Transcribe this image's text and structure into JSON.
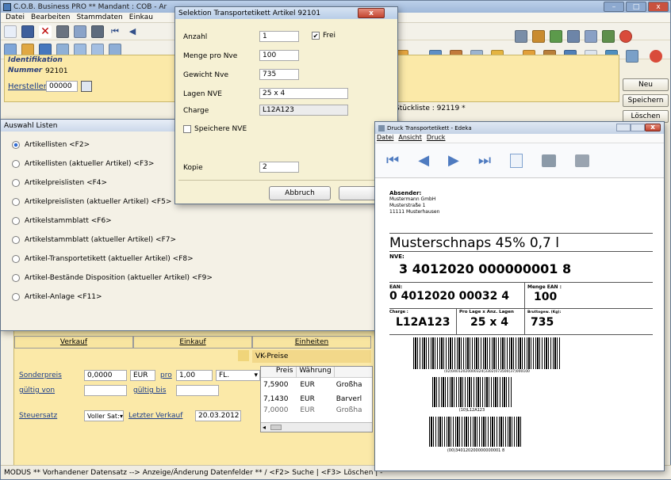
{
  "main_window": {
    "title": "C.O.B. Business PRO  ** Mandant : COB - Ar",
    "menu": [
      "Datei",
      "Bearbeiten",
      "Stammdaten",
      "Einkau"
    ],
    "window_controls": [
      "–",
      "□",
      "x"
    ]
  },
  "identification": {
    "heading": "Identifikation",
    "nummer_label": "Nummer",
    "nummer_value": "92101",
    "hersteller_label": "Hersteller",
    "hersteller_value": "00000",
    "stueckliste": "Stückliste : 92119 *"
  },
  "side_buttons": [
    "Neu",
    "Speichern",
    "Löschen"
  ],
  "selektion_dialog": {
    "title": "Selektion Transportetikett Artikel 92101",
    "close": "x",
    "fields": [
      {
        "label": "Anzahl",
        "value": "1"
      },
      {
        "label": "Menge pro Nve",
        "value": "100"
      },
      {
        "label": "Gewicht Nve",
        "value": "735"
      },
      {
        "label": "Lagen NVE",
        "value": "25 x 4"
      },
      {
        "label": "Charge",
        "value": "L12A123"
      }
    ],
    "frei_label": "Frei",
    "speichere_label": "Speichere NVE",
    "kopie_label": "Kopie",
    "kopie_value": "2",
    "abbruch": "Abbruch",
    "ok": "Ol"
  },
  "auswahl_dialog": {
    "title": "Auswahl Listen",
    "options": [
      "Artikellisten <F2>",
      "Artikellisten (aktueller Artikel) <F3>",
      "Artikelpreislisten <F4>",
      "Artikelpreislisten (aktueller Artikel) <F5>",
      "Artikelstammblatt <F6>",
      "Artikelstammblatt (aktueller Artikel) <F7>",
      "Artikel-Transportetikett (aktueller Artikel) <F8>",
      "Artikel-Bestände Disposition (aktueller Artikel) <F9>",
      "Artikel-Anlage <F11>"
    ],
    "selected_index": 0
  },
  "tabs": [
    "Verkauf",
    "Einkauf",
    "Einheiten"
  ],
  "verkauf": {
    "sonderpreis_label": "Sonderpreis",
    "sonderpreis_value": "0,0000",
    "currency": "EUR",
    "pro_label": "pro",
    "pro_value": "1,00",
    "unit": "FL.",
    "gueltig_von_label": "gültig von",
    "gueltig_bis_label": "gültig bis",
    "steuersatz_label": "Steuersatz",
    "steuersatz_value": "Voller Sat:",
    "letzter_verkauf_label": "Letzter Verkauf",
    "letzter_verkauf_value": "20.03.2012"
  },
  "vk_preise": {
    "heading": "VK-Preise",
    "columns": [
      "Preis",
      "Währung",
      ""
    ],
    "rows": [
      [
        "7,5900",
        "EUR",
        "Großha"
      ],
      [
        "7,1430",
        "EUR",
        "Barverl"
      ],
      [
        "7,0000",
        "EUR",
        "Großha"
      ]
    ]
  },
  "druck_window": {
    "title": "Druck Transportetikett - Edeka",
    "menu": [
      "Datei",
      "Ansicht",
      "Druck"
    ],
    "label": {
      "absender_heading": "Absender:",
      "absender_lines": [
        "Mustermann GmbH",
        "Musterstraße 1",
        "11111 Musterhausen"
      ],
      "product": "Musterschnaps 45% 0,7 l",
      "nve_label": "NVE:",
      "nve_value": "3 4012020 000000001 8",
      "ean_label": "EAN:",
      "ean_value": "0 4012020 00032 4",
      "menge_label": "Menge EAN :",
      "menge_value": "100",
      "charge_label": "Charge :",
      "charge_value": "L12A123",
      "lagen_label": "Pro Lage x Anz. Lagen",
      "lagen_value": "25 x 4",
      "gewicht_label": "Bruttogew. (Kg):",
      "gewicht_value": "735",
      "barcode1_text": "(02)04012020000324(3302)073500(37)000100",
      "barcode2_text": "(10)L12A123",
      "barcode3_text": "(00)340120200000000001 8"
    }
  },
  "status_bar": "MODUS ** Vorhandener Datensatz --> Anzeige/Änderung Datenfelder **  / <F2> Suche | <F3> Löschen | -"
}
